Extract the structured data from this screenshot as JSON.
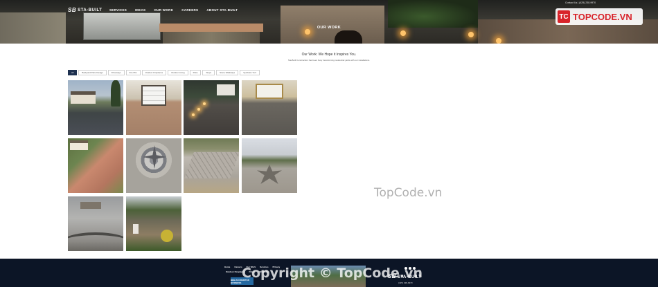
{
  "header": {
    "brand_mark": "SB",
    "brand_name": "STA-BUILT",
    "contact": "Contact Us | (425) 238-9970",
    "nav": [
      "SERVICES",
      "IDEAS",
      "OUR WORK",
      "CAREERS",
      "ABOUT STA-BUILT"
    ],
    "hero_title": "OUR WORK"
  },
  "badge": {
    "icon": "TC",
    "text": "TOPCODE.VN"
  },
  "intro": {
    "title": "Our Work: We Hope it Inspires You.",
    "subtitle": "Sta-Built Construction has been busy transforming residential yards with our installations."
  },
  "filters": [
    "All",
    "Backyard Patio Design",
    "Driveways",
    "Fire Pits",
    "Outdoor Fireplaces",
    "Outdoor Living",
    "Patio",
    "Steps",
    "Stone Walkways",
    "Synthetic Turf"
  ],
  "active_filter": "All",
  "gallery": [
    {
      "name": "house-driveway-photo",
      "alt": "Driveway with house"
    },
    {
      "name": "garage-paver-photo",
      "alt": "Garage paver driveway"
    },
    {
      "name": "lit-driveway-photo",
      "alt": "Lit driveway at dusk"
    },
    {
      "name": "gold-garage-photo",
      "alt": "Garage with paver driveway"
    },
    {
      "name": "brick-walkway-photo",
      "alt": "Brick walkway"
    },
    {
      "name": "compass-paver-photo",
      "alt": "Compass rose paver"
    },
    {
      "name": "stone-path-photo",
      "alt": "Stone path"
    },
    {
      "name": "flower-paver-photo",
      "alt": "Flower paver design"
    },
    {
      "name": "paver-curve-photo",
      "alt": "Curved paver patio"
    },
    {
      "name": "garden-path-photo",
      "alt": "Garden path"
    }
  ],
  "footer": {
    "links_row1": [
      "Home",
      "Careers",
      "Our Work",
      "Services",
      "Privacy"
    ],
    "links_row2": [
      "Outdoor Fireplaces",
      "Patios",
      "Walkways"
    ],
    "bbb": "BBB ACCREDITED BUSINESS",
    "brand_mark": "SB",
    "brand_name": "STA-BUILT",
    "phone": "(425) 238-9970"
  },
  "watermarks": {
    "middle": "TopCode.vn",
    "footer": "Copyright © TopCode.vn"
  },
  "colors": {
    "nav_active_tab": "#1e3150",
    "footer_bg": "#0c1526",
    "badge_red": "#d8232a"
  }
}
